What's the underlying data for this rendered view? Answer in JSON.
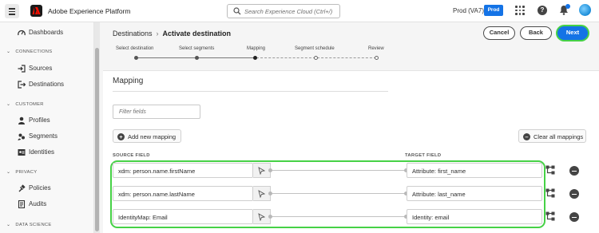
{
  "header": {
    "app_title": "Adobe Experience Platform",
    "search_placeholder": "Search Experience Cloud (Ctrl+/)",
    "org_name": "Prod (VA7)",
    "sandbox_badge": "Prod",
    "accent_color": "#1473e6"
  },
  "sidebar": {
    "items": [
      {
        "label": "Dashboards",
        "icon": "dashboard-icon"
      },
      {
        "section": "CONNECTIONS"
      },
      {
        "label": "Sources",
        "icon": "sources-icon"
      },
      {
        "label": "Destinations",
        "icon": "destinations-icon"
      },
      {
        "section": "CUSTOMER"
      },
      {
        "label": "Profiles",
        "icon": "profile-icon"
      },
      {
        "label": "Segments",
        "icon": "segments-icon"
      },
      {
        "label": "Identities",
        "icon": "identities-icon"
      },
      {
        "section": "PRIVACY"
      },
      {
        "label": "Policies",
        "icon": "policies-icon"
      },
      {
        "label": "Audits",
        "icon": "audits-icon"
      },
      {
        "section": "DATA SCIENCE"
      }
    ]
  },
  "page": {
    "breadcrumb_parent": "Destinations",
    "breadcrumb_current": "Activate destination",
    "cancel_label": "Cancel",
    "back_label": "Back",
    "next_label": "Next"
  },
  "steps": [
    {
      "label": "Select destination",
      "state": "done"
    },
    {
      "label": "Select segments",
      "state": "done"
    },
    {
      "label": "Mapping",
      "state": "current"
    },
    {
      "label": "Segment schedule",
      "state": "pending"
    },
    {
      "label": "Review",
      "state": "pending"
    }
  ],
  "mapping": {
    "title": "Mapping",
    "filter_placeholder": "Filter fields",
    "add_label": "Add new mapping",
    "clear_label": "Clear all mappings",
    "source_header": "SOURCE FIELD",
    "target_header": "TARGET FIELD",
    "rows": [
      {
        "source": "xdm: person.name.firstName",
        "target": "Attribute: first_name"
      },
      {
        "source": "xdm: person.name.lastName",
        "target": "Attribute: last_name"
      },
      {
        "source": "IdentityMap: Email",
        "target": "Identity: email"
      }
    ],
    "highlight_color": "#46d146"
  }
}
